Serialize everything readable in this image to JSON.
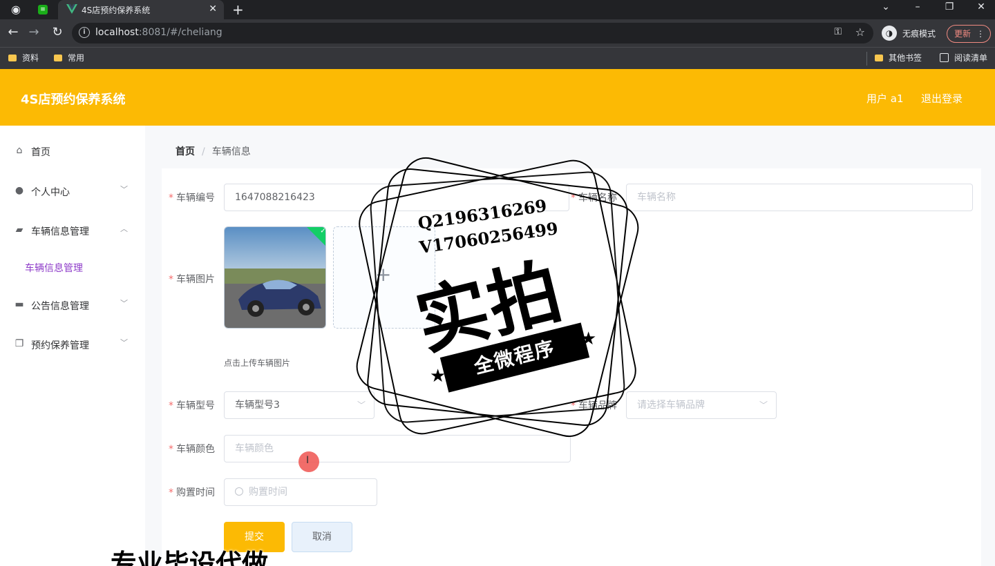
{
  "browser": {
    "tab_title": "4S店预约保养系统",
    "url_host": "localhost",
    "url_rest": ":8081/#/cheliang",
    "incognito_label": "无痕模式",
    "update_label": "更新",
    "bookmarks": [
      "资料",
      "常用"
    ],
    "bookmarks_right": [
      "其他书签",
      "阅读清单"
    ]
  },
  "header": {
    "title": "4S店预约保养系统",
    "user": "用户 a1",
    "logout": "退出登录",
    "color": "#fcba04"
  },
  "sidebar": {
    "items": [
      {
        "label": "首页",
        "icon": "home-icon"
      },
      {
        "label": "个人中心",
        "icon": "user-icon"
      },
      {
        "label": "车辆信息管理",
        "icon": "wallet-icon"
      },
      {
        "label": "公告信息管理",
        "icon": "monitor-icon"
      },
      {
        "label": "预约保养管理",
        "icon": "copy-icon"
      }
    ],
    "active_sub": "车辆信息管理",
    "active_color": "#8e3cc9"
  },
  "breadcrumb": {
    "home": "首页",
    "separator": "/",
    "current": "车辆信息"
  },
  "form": {
    "vehicle_no": {
      "label": "车辆编号",
      "value": "1647088216423"
    },
    "vehicle_name": {
      "label": "车辆名称",
      "placeholder": "车辆名称"
    },
    "vehicle_image": {
      "label": "车辆图片",
      "tip": "点击上传车辆图片"
    },
    "vehicle_model": {
      "label": "车辆型号",
      "value": "车辆型号3"
    },
    "vehicle_brand": {
      "label": "车辆品牌",
      "placeholder": "请选择车辆品牌"
    },
    "vehicle_color": {
      "label": "车辆颜色",
      "placeholder": "车辆颜色"
    },
    "purchase_time": {
      "label": "购置时间",
      "placeholder": "购置时间"
    },
    "submit": "提交",
    "cancel": "取消"
  },
  "watermark": {
    "line1": "Q2196316269",
    "line2": "V17060256499",
    "big": "实拍",
    "ribbon": "全微程序",
    "bottom": "专业毕设代做"
  }
}
